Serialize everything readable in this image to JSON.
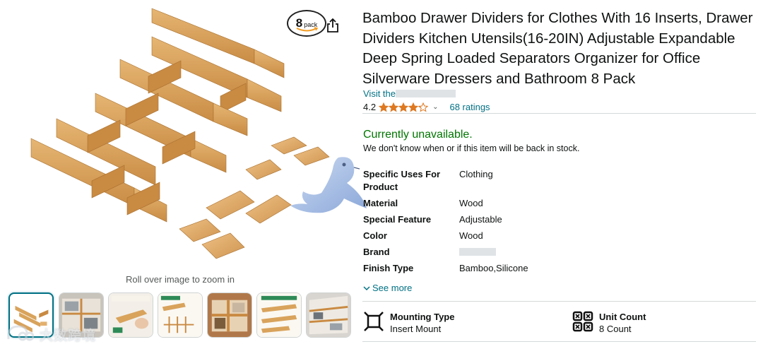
{
  "gallery": {
    "pack_badge": {
      "number": "8",
      "word": "pack"
    },
    "zoom_hint": "Roll over image to zoom in",
    "thumbnails": [
      {
        "alt": "thumb-1",
        "selected": true
      },
      {
        "alt": "thumb-2",
        "selected": false
      },
      {
        "alt": "thumb-3",
        "selected": false
      },
      {
        "alt": "thumb-4",
        "selected": false
      },
      {
        "alt": "thumb-5",
        "selected": false
      },
      {
        "alt": "thumb-6",
        "selected": false
      },
      {
        "alt": "thumb-7",
        "selected": false
      }
    ],
    "watermark_text": "大数跨境"
  },
  "product": {
    "title": "Bamboo Drawer Dividers for Clothes With 16 Inserts, Drawer Dividers Kitchen Utensils(16-20IN) Adjustable Expandable Deep Spring Loaded Separators Organizer for Office Silverware Dressers and Bathroom 8 Pack",
    "visit_store_prefix": "Visit the",
    "rating_value": "4.2",
    "stars_filled": 4.2,
    "ratings_count": "68 ratings",
    "availability": "Currently unavailable.",
    "stock_note": "We don't know when or if this item will be back in stock."
  },
  "specs": [
    {
      "key": "Specific Uses For Product",
      "value": "Clothing"
    },
    {
      "key": "Material",
      "value": "Wood"
    },
    {
      "key": "Special Feature",
      "value": "Adjustable"
    },
    {
      "key": "Color",
      "value": "Wood"
    },
    {
      "key": "Brand",
      "value": ""
    },
    {
      "key": "Finish Type",
      "value": "Bamboo,Silicone"
    }
  ],
  "see_more": "See more",
  "features": [
    {
      "title": "Mounting Type",
      "value": "Insert Mount",
      "icon": "mount-icon"
    },
    {
      "title": "Unit Count",
      "value": "8 Count",
      "icon": "grid-count-icon"
    }
  ],
  "colors": {
    "link": "#007185",
    "available_green": "#007600",
    "star": "#de7921",
    "bamboo": "#d9a35c",
    "bamboo_dark": "#b97a36"
  }
}
